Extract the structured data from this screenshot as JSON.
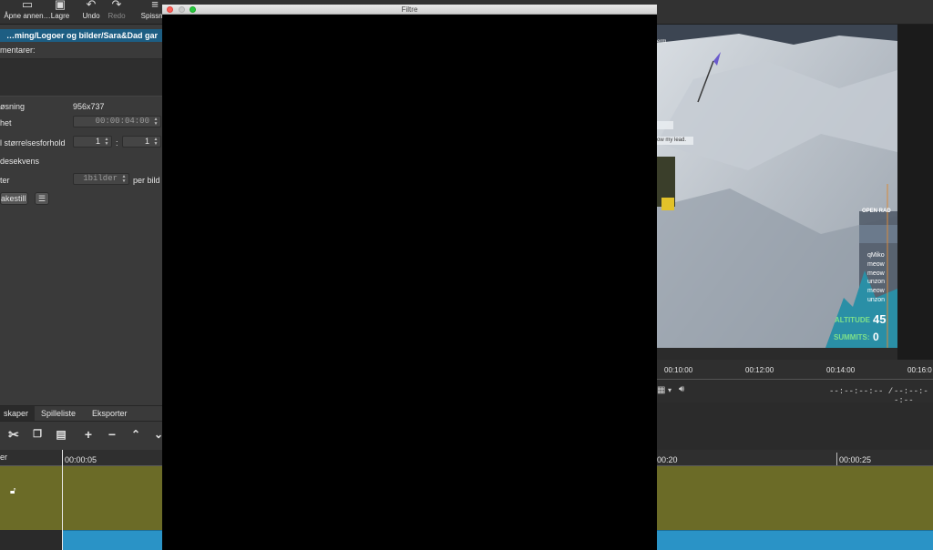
{
  "toolbar": {
    "open": "Åpne annen…",
    "save": "Lagre",
    "undo": "Undo",
    "redo": "Redo",
    "spismo": "Spissmo"
  },
  "properties": {
    "resource_name": "…ming/Logoer og bilder/Sara&Dad gar",
    "comments_label": "mentarer:",
    "resolution_label": "øsning",
    "resolution_value": "956x737",
    "duration_label": "het",
    "duration_value": "00:00:04:00",
    "aspect_label": "l størrelsesforhold",
    "aspect_num": "1",
    "aspect_sep": ":",
    "aspect_den": "1",
    "sequence_label": "desekvens",
    "frames_label": "ter",
    "frames_value": "1bilder",
    "per_label": "per bild",
    "preset_label": "akestill",
    "menu_glyph": "☰"
  },
  "tabs": [
    "skaper",
    "Spilleliste",
    "Eksporter"
  ],
  "timeline_tools": {
    "header_label": "er",
    "playhead_time": "00:00:05",
    "right_time_1": "00:20",
    "right_time_2": "00:00:25"
  },
  "filtre": {
    "title": "Filtre"
  },
  "video": {
    "chat_1": "qMiko",
    "chat_2": "meow",
    "chat_3": "meow",
    "chat_4": "unzon",
    "chat_5": "meow",
    "chat_6": "unzon",
    "side_label": "OPEN RAD",
    "altitude_label": "ALTITUDE",
    "altitude_value": "45",
    "summits_label": "SUMMITS:",
    "summits_value": "0",
    "bubble_1": "ow my lead.",
    "corner_text": "erm"
  },
  "ruler": {
    "ticks": [
      "00:10:00",
      "00:12:00",
      "00:14:00",
      "00:16:0"
    ]
  },
  "player": {
    "timecode_1": "--:--:--:-- /",
    "timecode_2": "--:--:--:--"
  },
  "colors": {
    "accent": "#1d5e83",
    "track_video": "#6b6b27",
    "track_audio": "#2a93c6",
    "window_bg": "#000000"
  }
}
